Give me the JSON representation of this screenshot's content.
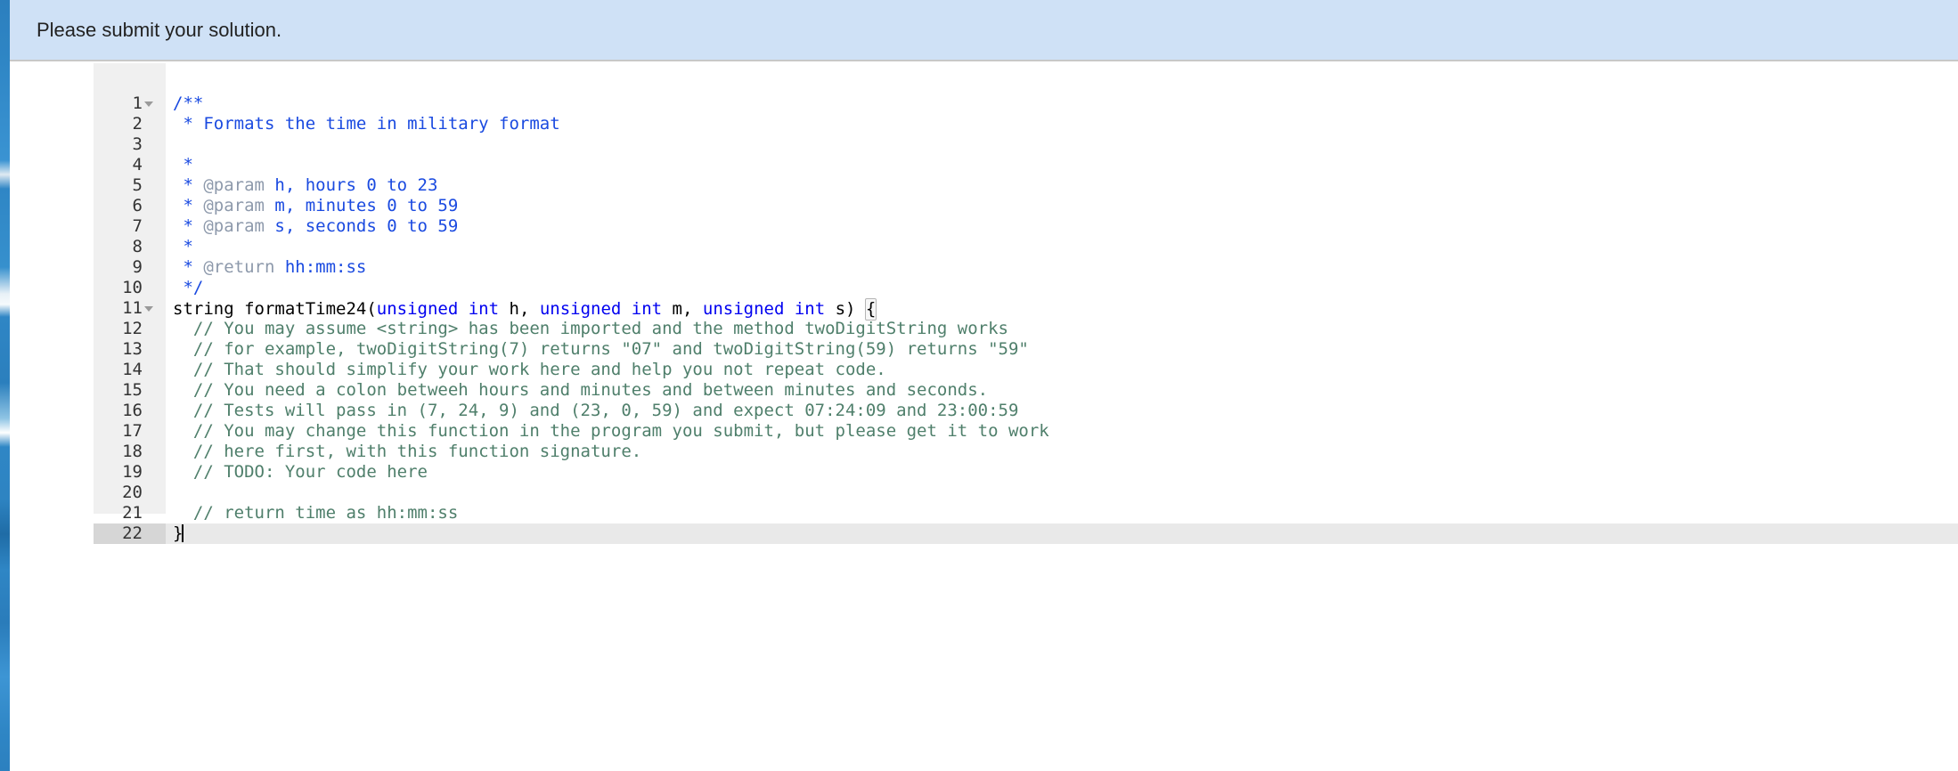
{
  "banner": {
    "message": "Please submit your solution."
  },
  "editor": {
    "active_line": 22,
    "fold_lines": [
      1,
      11
    ],
    "cursor_line": 22,
    "colors": {
      "banner_background": "#cfe1f6",
      "gutter_background": "#f0f0f0",
      "active_line_background": "#e9e9e9",
      "active_gutter_background": "#d6d6d6",
      "doc_comment": "#1a4ae0",
      "doc_tag": "#8d99ab",
      "keyword": "#0000f0",
      "line_comment": "#4f7f6b",
      "plain_text": "#000000",
      "left_strip": "#2f86c5"
    },
    "lines": [
      {
        "n": "1",
        "tokens": [
          {
            "t": "doc",
            "s": "/**"
          }
        ]
      },
      {
        "n": "2",
        "tokens": [
          {
            "t": "doc",
            "s": " * Formats the time in military format"
          }
        ]
      },
      {
        "n": "3",
        "tokens": [
          {
            "t": "doc",
            "s": ""
          }
        ]
      },
      {
        "n": "4",
        "tokens": [
          {
            "t": "doc",
            "s": " *"
          }
        ]
      },
      {
        "n": "5",
        "tokens": [
          {
            "t": "doc",
            "s": " * "
          },
          {
            "t": "tag",
            "s": "@param"
          },
          {
            "t": "doc",
            "s": " h, hours 0 to 23"
          }
        ]
      },
      {
        "n": "6",
        "tokens": [
          {
            "t": "doc",
            "s": " * "
          },
          {
            "t": "tag",
            "s": "@param"
          },
          {
            "t": "doc",
            "s": " m, minutes 0 to 59"
          }
        ]
      },
      {
        "n": "7",
        "tokens": [
          {
            "t": "doc",
            "s": " * "
          },
          {
            "t": "tag",
            "s": "@param"
          },
          {
            "t": "doc",
            "s": " s, seconds 0 to 59"
          }
        ]
      },
      {
        "n": "8",
        "tokens": [
          {
            "t": "doc",
            "s": " *"
          }
        ]
      },
      {
        "n": "9",
        "tokens": [
          {
            "t": "doc",
            "s": " * "
          },
          {
            "t": "tag",
            "s": "@return"
          },
          {
            "t": "doc",
            "s": " hh:mm:ss"
          }
        ]
      },
      {
        "n": "10",
        "tokens": [
          {
            "t": "doc",
            "s": " */"
          }
        ]
      },
      {
        "n": "11",
        "tokens": [
          {
            "t": "plain",
            "s": "string formatTime24("
          },
          {
            "t": "kw",
            "s": "unsigned int"
          },
          {
            "t": "plain",
            "s": " h, "
          },
          {
            "t": "kw",
            "s": "unsigned int"
          },
          {
            "t": "plain",
            "s": " m, "
          },
          {
            "t": "kw",
            "s": "unsigned int"
          },
          {
            "t": "plain",
            "s": " s) "
          },
          {
            "t": "brace",
            "s": "{"
          }
        ]
      },
      {
        "n": "12",
        "tokens": [
          {
            "t": "cmt",
            "s": "  // You may assume <string> has been imported and the method twoDigitString works"
          }
        ]
      },
      {
        "n": "13",
        "tokens": [
          {
            "t": "cmt",
            "s": "  // for example, twoDigitString(7) returns \"07\" and twoDigitString(59) returns \"59\""
          }
        ]
      },
      {
        "n": "14",
        "tokens": [
          {
            "t": "cmt",
            "s": "  // That should simplify your work here and help you not repeat code."
          }
        ]
      },
      {
        "n": "15",
        "tokens": [
          {
            "t": "cmt",
            "s": "  // You need a colon betweeh hours and minutes and between minutes and seconds."
          }
        ]
      },
      {
        "n": "16",
        "tokens": [
          {
            "t": "cmt",
            "s": "  // Tests will pass in (7, 24, 9) and (23, 0, 59) and expect 07:24:09 and 23:00:59"
          }
        ]
      },
      {
        "n": "17",
        "tokens": [
          {
            "t": "cmt",
            "s": "  // You may change this function in the program you submit, but please get it to work"
          }
        ]
      },
      {
        "n": "18",
        "tokens": [
          {
            "t": "cmt",
            "s": "  // here first, with this function signature."
          }
        ]
      },
      {
        "n": "19",
        "tokens": [
          {
            "t": "cmt",
            "s": "  // TODO: Your code here"
          }
        ]
      },
      {
        "n": "20",
        "tokens": [
          {
            "t": "plain",
            "s": ""
          }
        ]
      },
      {
        "n": "21",
        "tokens": [
          {
            "t": "cmt",
            "s": "  // return time as hh:mm:ss"
          }
        ]
      },
      {
        "n": "22",
        "tokens": [
          {
            "t": "plain",
            "s": "}"
          },
          {
            "t": "caret",
            "s": ""
          }
        ]
      }
    ]
  }
}
